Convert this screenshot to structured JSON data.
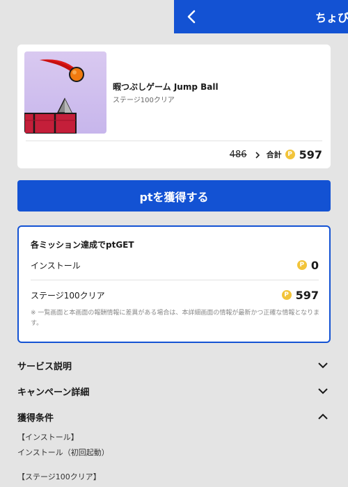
{
  "header": {
    "back_icon": "chevron-left-icon",
    "title": "ちょびリッチ",
    "background": "#1352d3"
  },
  "offer": {
    "thumbnail": "jump-ball-game-icon",
    "title": "暇つぶしゲーム Jump Ball",
    "subtitle": "ステージ100クリア",
    "old_points": "486",
    "total_label": "合計",
    "coin_symbol": "P",
    "total_points": "597"
  },
  "cta": {
    "label": "ptを獲得する"
  },
  "missions": {
    "title": "各ミッション達成でptGET",
    "items": [
      {
        "label": "インストール",
        "points": "0"
      },
      {
        "label": "ステージ100クリア",
        "points": "597"
      }
    ],
    "note": "※ 一覧画面と本画面の報酬情報に差異がある場合は、本詳細画面の情報が最新かつ正確な情報となります。"
  },
  "accordions": [
    {
      "label": "サービス説明",
      "state": "collapsed"
    },
    {
      "label": "キャンペーン詳細",
      "state": "collapsed"
    },
    {
      "label": "獲得条件",
      "state": "expanded"
    }
  ],
  "conditions": {
    "line1": "【インストール】",
    "line2": "インストール（初回起動）",
    "line3": "【ステージ100クリア】"
  },
  "colors": {
    "accent": "#1352d3",
    "coin": "#f2c43a",
    "background": "#e4e4e4"
  }
}
